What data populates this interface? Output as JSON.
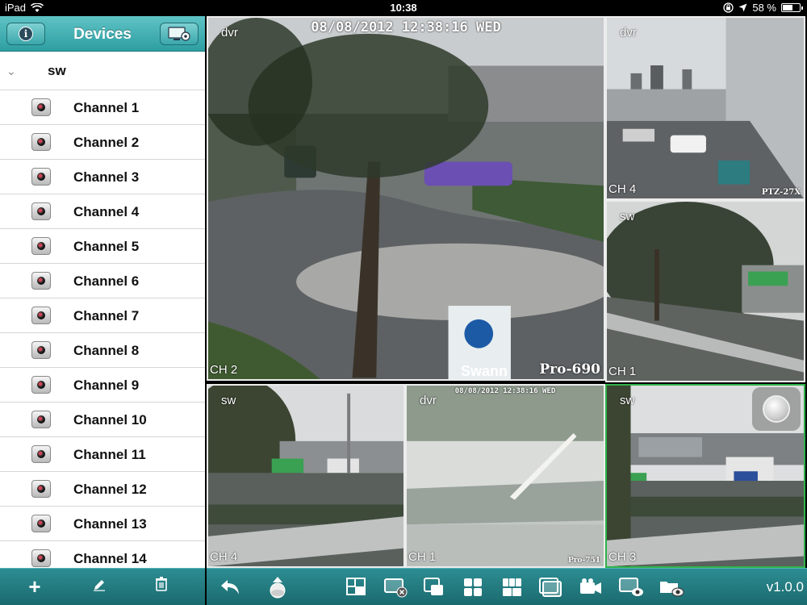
{
  "status": {
    "device": "iPad",
    "time": "10:38",
    "battery": "58 %",
    "battery_level": 0.58
  },
  "sidebar": {
    "title": "Devices",
    "group": "sw",
    "channels": [
      "Channel 1",
      "Channel 2",
      "Channel 3",
      "Channel 4",
      "Channel 5",
      "Channel 6",
      "Channel 7",
      "Channel 8",
      "Channel 9",
      "Channel 10",
      "Channel 11",
      "Channel 12",
      "Channel 13",
      "Channel 14"
    ]
  },
  "tiles": [
    {
      "device": "dvr",
      "channel": "CH 2",
      "osd": "08/08/2012 12:38:16 WED",
      "watermark": "Pro-690",
      "logo": "Swann"
    },
    {
      "device": "dvr",
      "channel": "CH 4",
      "osd": "",
      "watermark": "PTZ-27X",
      "logo": ""
    },
    {
      "device": "sw",
      "channel": "CH 1",
      "osd": "",
      "watermark": "",
      "logo": ""
    },
    {
      "device": "sw",
      "channel": "CH 4",
      "osd": "",
      "watermark": "",
      "logo": ""
    },
    {
      "device": "dvr",
      "channel": "CH 1",
      "osd": "08/08/2012 12:38:16 WED",
      "watermark": "Pro-751",
      "logo": ""
    },
    {
      "device": "sw",
      "channel": "CH 3",
      "osd": "",
      "watermark": "",
      "logo": ""
    }
  ],
  "toolbar": {
    "version": "v1.0.0"
  },
  "colors": {
    "teal": "#2e9ea2",
    "active_border": "#2fb34a"
  }
}
